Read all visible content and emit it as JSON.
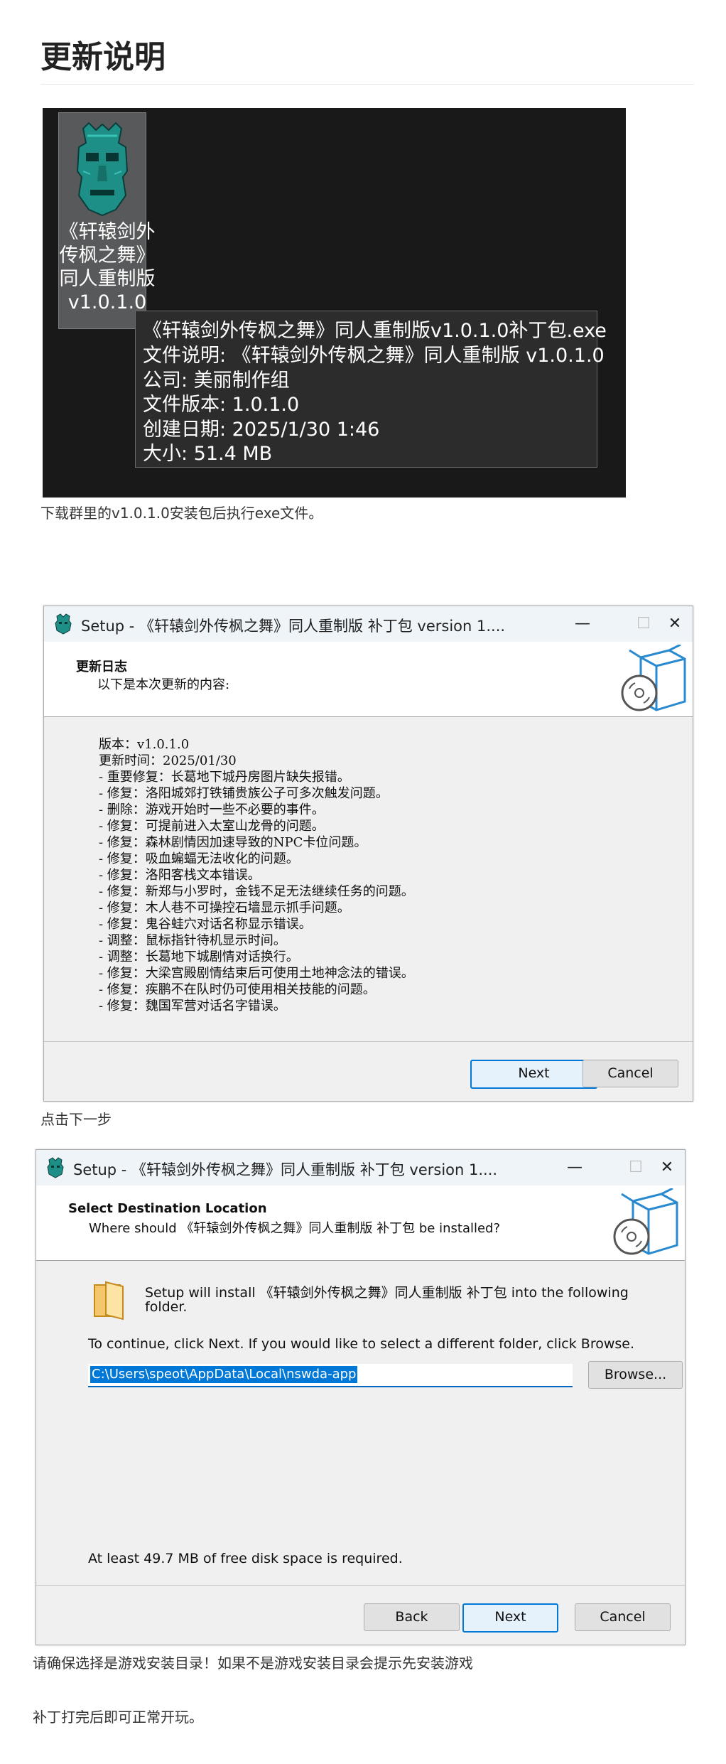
{
  "page": {
    "title": "更新说明",
    "caption1": "下载群里的v1.0.1.0安装包后执行exe文件。",
    "caption2": "点击下一步",
    "caption3": "请确保选择是游戏安装目录！如果不是游戏安装目录会提示先安装游戏",
    "caption4": "补丁打完后即可正常开玩。"
  },
  "explorer": {
    "icon_label": [
      "《轩辕剑外",
      "传枫之舞》",
      "同人重制版",
      "v1.0.1.0"
    ],
    "tooltip": [
      "《轩辕剑外传枫之舞》同人重制版v1.0.1.0补丁包.exe",
      "文件说明: 《轩辕剑外传枫之舞》同人重制版 v1.0.1.0",
      "公司: 美丽制作组",
      "文件版本: 1.0.1.0",
      "创建日期: 2025/1/30 1:46",
      "大小: 51.4 MB"
    ]
  },
  "dialog1": {
    "title": "Setup - 《轩辕剑外传枫之舞》同人重制版 补丁包 version 1....",
    "header_title": "更新日志",
    "header_subtitle": "以下是本次更新的内容:",
    "changelog": [
      "版本：v1.0.1.0",
      "更新时间：2025/01/30",
      "- 重要修复：长葛地下城丹房图片缺失报错。",
      "- 修复：洛阳城郊打铁铺贵族公子可多次触发问题。",
      "- 删除：游戏开始时一些不必要的事件。",
      "- 修复：可提前进入太室山龙骨的问题。",
      "- 修复：森林剧情因加速导致的NPC卡位问题。",
      "- 修复：吸血蝙蝠无法收化的问题。",
      "- 修复：洛阳客栈文本错误。",
      "- 修复：新郑与小罗时，金钱不足无法继续任务的问题。",
      "- 修复：木人巷不可操控石墙显示抓手问题。",
      "- 修复：鬼谷蛙穴对话名称显示错误。",
      "- 调整：鼠标指针待机显示时间。",
      "- 调整：长葛地下城剧情对话换行。",
      "- 修复：大梁宫殿剧情结束后可使用土地神念法的错误。",
      "- 修复：疾鹏不在队时仍可使用相关技能的问题。",
      "- 修复：魏国军营对话名字错误。"
    ],
    "next_label": "Next",
    "cancel_label": "Cancel",
    "minimize": "—",
    "maximize": "☐",
    "close": "✕"
  },
  "dialog2": {
    "title": "Setup - 《轩辕剑外传枫之舞》同人重制版 补丁包 version 1....",
    "header_title": "Select Destination Location",
    "header_subtitle": "Where should 《轩辕剑外传枫之舞》同人重制版 补丁包 be installed?",
    "install_line1": "Setup will install 《轩辕剑外传枫之舞》同人重制版 补丁包 into the following",
    "install_line2": "folder.",
    "continue_text": "To continue, click Next. If you would like to select a different folder, click Browse.",
    "path_value": "C:\\Users\\speot\\AppData\\Local\\nswda-app",
    "browse_label": "Browse...",
    "disk_space": "At least 49.7 MB of free disk space is required.",
    "back_label": "Back",
    "next_label": "Next",
    "cancel_label": "Cancel",
    "minimize": "—",
    "maximize": "☐",
    "close": "✕"
  },
  "colors": {
    "accent": "#0078d7",
    "tooltip_bg": "#2c2c2c",
    "explorer_bg": "#191919"
  }
}
